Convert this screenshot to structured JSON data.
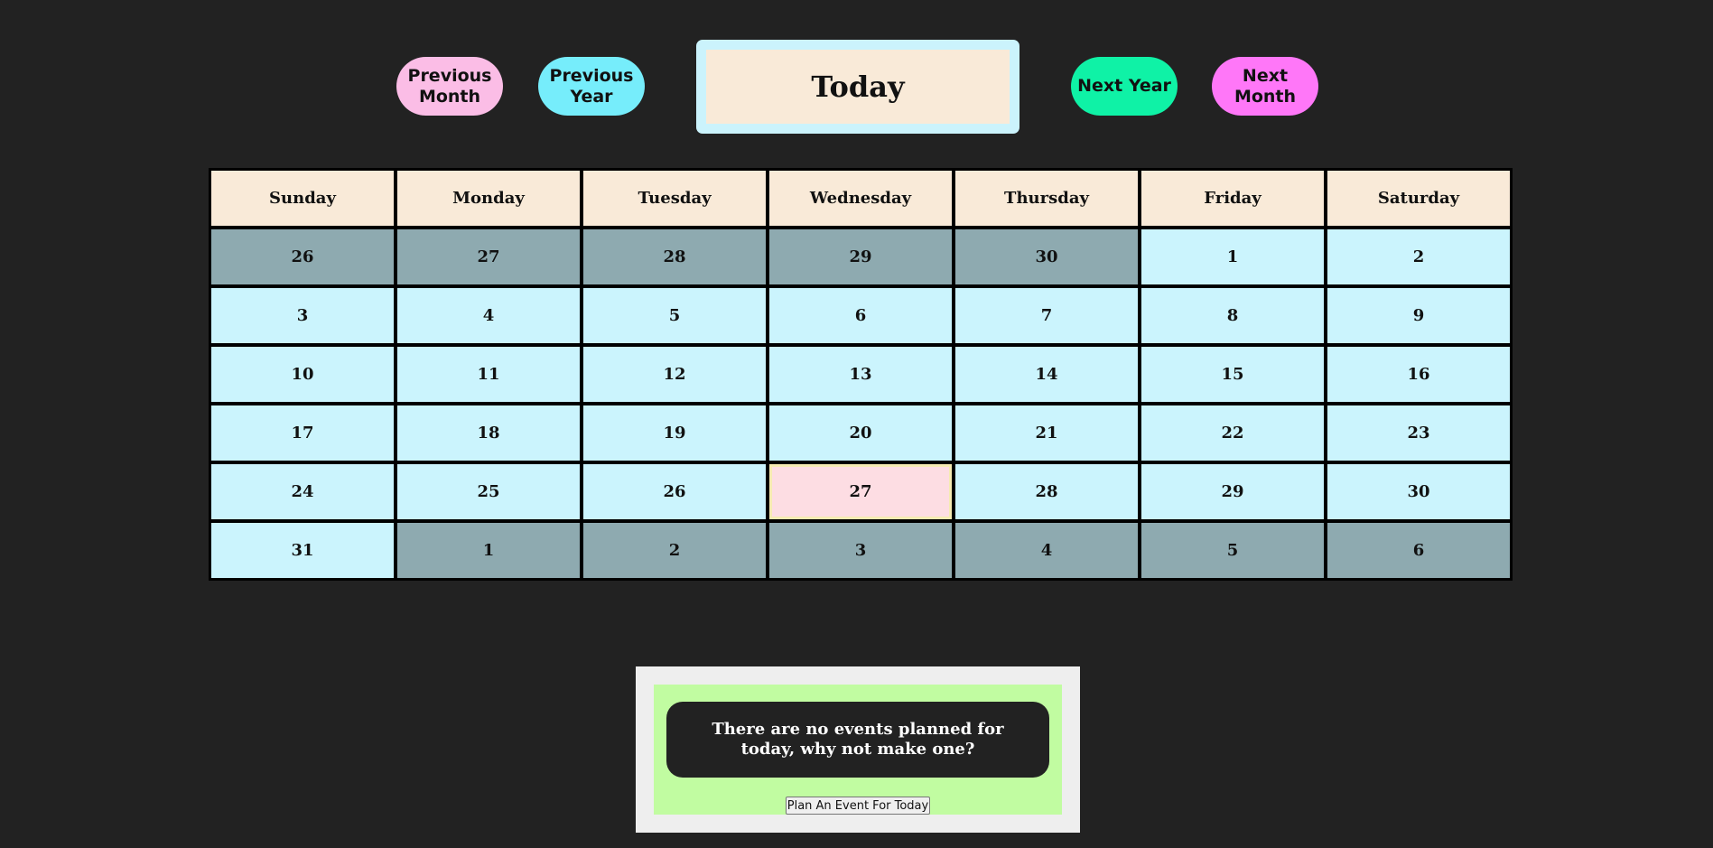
{
  "nav": {
    "previous_month": "Previous Month",
    "previous_year": "Previous Year",
    "today": "Today",
    "next_year": "Next Year",
    "next_month": "Next Month"
  },
  "calendar": {
    "weekdays": [
      "Sunday",
      "Monday",
      "Tuesday",
      "Wednesday",
      "Thursday",
      "Friday",
      "Saturday"
    ],
    "weeks": [
      [
        {
          "d": "26",
          "s": "other"
        },
        {
          "d": "27",
          "s": "other"
        },
        {
          "d": "28",
          "s": "other"
        },
        {
          "d": "29",
          "s": "other"
        },
        {
          "d": "30",
          "s": "other"
        },
        {
          "d": "1",
          "s": "current"
        },
        {
          "d": "2",
          "s": "current"
        }
      ],
      [
        {
          "d": "3",
          "s": "current"
        },
        {
          "d": "4",
          "s": "current"
        },
        {
          "d": "5",
          "s": "current"
        },
        {
          "d": "6",
          "s": "current"
        },
        {
          "d": "7",
          "s": "current"
        },
        {
          "d": "8",
          "s": "current"
        },
        {
          "d": "9",
          "s": "current"
        }
      ],
      [
        {
          "d": "10",
          "s": "current"
        },
        {
          "d": "11",
          "s": "current"
        },
        {
          "d": "12",
          "s": "current"
        },
        {
          "d": "13",
          "s": "current"
        },
        {
          "d": "14",
          "s": "current"
        },
        {
          "d": "15",
          "s": "current"
        },
        {
          "d": "16",
          "s": "current"
        }
      ],
      [
        {
          "d": "17",
          "s": "current"
        },
        {
          "d": "18",
          "s": "current"
        },
        {
          "d": "19",
          "s": "current"
        },
        {
          "d": "20",
          "s": "current"
        },
        {
          "d": "21",
          "s": "current"
        },
        {
          "d": "22",
          "s": "current"
        },
        {
          "d": "23",
          "s": "current"
        }
      ],
      [
        {
          "d": "24",
          "s": "current"
        },
        {
          "d": "25",
          "s": "current"
        },
        {
          "d": "26",
          "s": "current"
        },
        {
          "d": "27",
          "s": "today"
        },
        {
          "d": "28",
          "s": "current"
        },
        {
          "d": "29",
          "s": "current"
        },
        {
          "d": "30",
          "s": "current"
        }
      ],
      [
        {
          "d": "31",
          "s": "current"
        },
        {
          "d": "1",
          "s": "other"
        },
        {
          "d": "2",
          "s": "other"
        },
        {
          "d": "3",
          "s": "other"
        },
        {
          "d": "4",
          "s": "other"
        },
        {
          "d": "5",
          "s": "other"
        },
        {
          "d": "6",
          "s": "other"
        }
      ]
    ]
  },
  "events": {
    "message": "There are no events planned for today, why not make one?",
    "plan_button": "Plan An Event For Today"
  },
  "colors": {
    "background": "#222222",
    "previous_month": "#FBBDE6",
    "previous_year": "#76EDFB",
    "next_year": "#0FF2A6",
    "next_month": "#FF77F8",
    "weekday_header": "#F9EAD8",
    "current_month_day": "#CBF4FD",
    "other_month_day": "#8EAAB0",
    "today_cell": "#FDDDE3",
    "events_panel": "#C1FCA1"
  }
}
